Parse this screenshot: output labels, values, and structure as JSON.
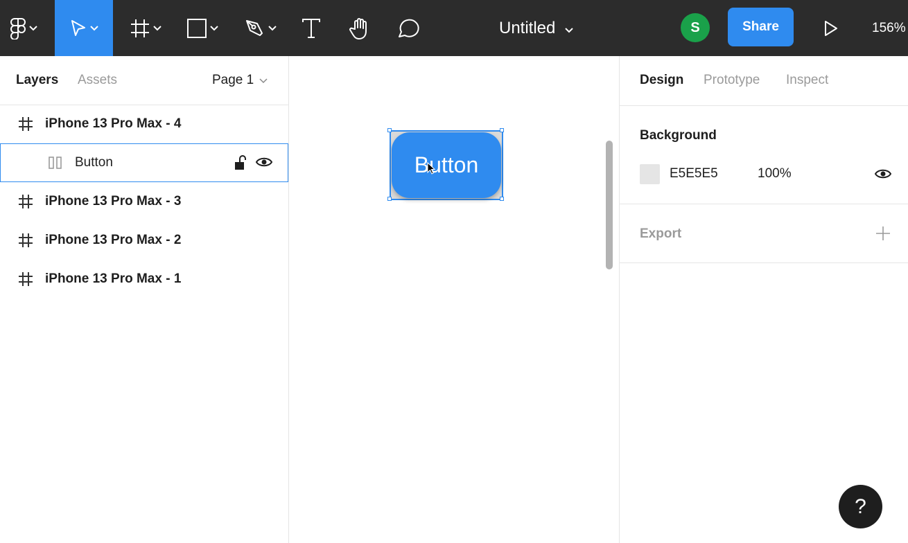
{
  "toolbar": {
    "document_title": "Untitled",
    "avatar_initial": "S",
    "share_label": "Share",
    "zoom_level": "156%",
    "active_tool": "move-tool",
    "accent_color": "#2f8bef"
  },
  "left_panel": {
    "tabs": [
      "Layers",
      "Assets"
    ],
    "page_selector": "Page 1",
    "layers": [
      {
        "label": "iPhone 13 Pro Max - 4",
        "type": "frame"
      },
      {
        "label": "Button",
        "type": "component",
        "selected": true
      },
      {
        "label": "iPhone 13 Pro Max - 3",
        "type": "frame"
      },
      {
        "label": "iPhone 13 Pro Max - 2",
        "type": "frame"
      },
      {
        "label": "iPhone 13 Pro Max - 1",
        "type": "frame"
      }
    ]
  },
  "canvas": {
    "button_label": "Button"
  },
  "right_panel": {
    "tabs": [
      "Design",
      "Prototype",
      "Inspect"
    ],
    "background": {
      "title": "Background",
      "hex": "E5E5E5",
      "opacity": "100%",
      "swatch_color": "#e5e5e5"
    },
    "export": {
      "title": "Export"
    }
  },
  "help_label": "?"
}
